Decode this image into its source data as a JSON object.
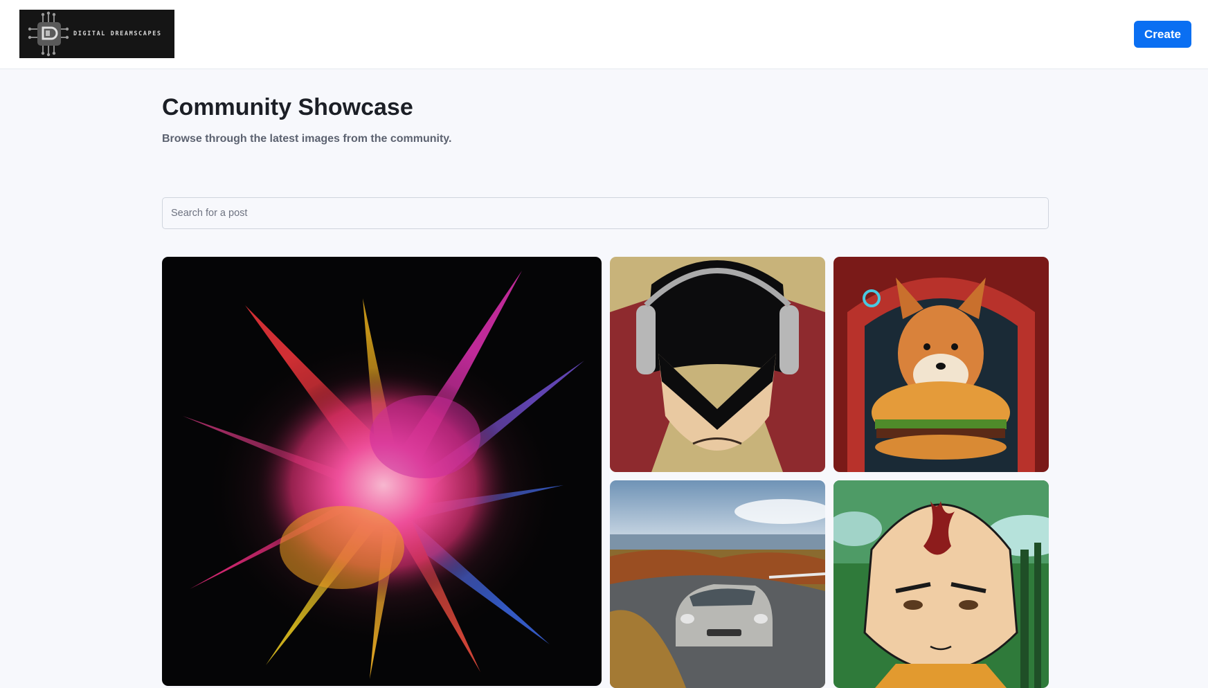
{
  "header": {
    "brand_name": "DIGITAL DREAMSCAPES",
    "create_label": "Create"
  },
  "main": {
    "title": "Community Showcase",
    "subtitle": "Browse through the latest images from the community.",
    "search": {
      "placeholder": "Search for a post",
      "value": ""
    }
  },
  "gallery": {
    "items": [
      {
        "subject": "color-powder-explosion"
      },
      {
        "subject": "masked-hero-with-headphones"
      },
      {
        "subject": "shiba-dog-with-burger"
      },
      {
        "subject": "silver-car-on-hillside"
      },
      {
        "subject": "monk-boy-with-flame-mark"
      }
    ]
  },
  "colors": {
    "accent": "#0a6ff2",
    "page_background": "#f7f8fc",
    "header_background": "#ffffff",
    "title_text": "#1c1f26",
    "subtitle_text": "#5c6270"
  }
}
